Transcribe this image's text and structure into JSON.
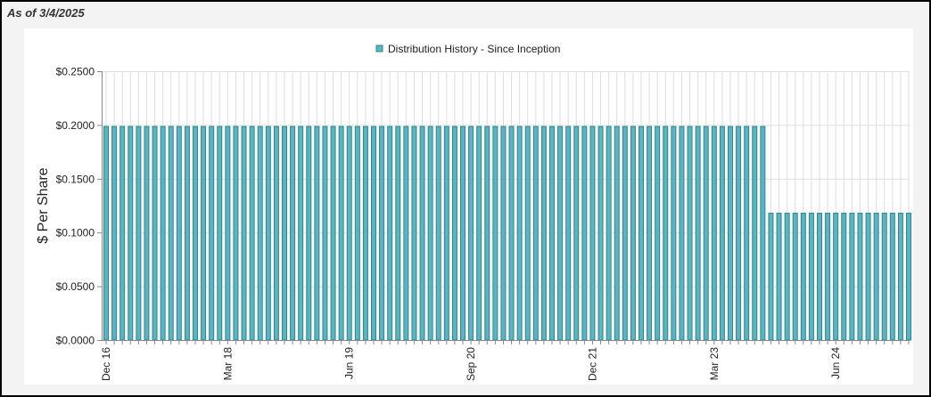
{
  "header": {
    "as_of": "As of 3/4/2025"
  },
  "chart_data": {
    "type": "bar",
    "title": "",
    "legend": [
      "Distribution History - Since Inception"
    ],
    "legend_placement": "top-center",
    "ylabel": "$ Per Share",
    "xlabel": "",
    "ylim": [
      0,
      0.25
    ],
    "yticks": [
      "$0.0000",
      "$0.0500",
      "$0.1000",
      "$0.1500",
      "$0.2000",
      "$0.2500"
    ],
    "ytick_values": [
      0,
      0.05,
      0.1,
      0.15,
      0.2,
      0.25
    ],
    "x_start": "Dec 2016",
    "x_end": "Mar 2025",
    "frequency": "monthly",
    "xtick_labels": [
      "Dec 16",
      "Mar 18",
      "Jun 19",
      "Sep 20",
      "Dec 21",
      "Mar 23",
      "Jun 24"
    ],
    "xtick_every": 15,
    "segments": [
      {
        "from": "Dec 2016",
        "to": "Sep 2023",
        "count": 82,
        "value": 0.1986
      },
      {
        "from": "Oct 2023",
        "to": "Mar 2025",
        "count": 18,
        "value": 0.118
      }
    ],
    "grid": true,
    "colors": {
      "bar": "#5bb4c0",
      "bar_edge": "#2a8790",
      "grid": "#dddddd"
    }
  }
}
